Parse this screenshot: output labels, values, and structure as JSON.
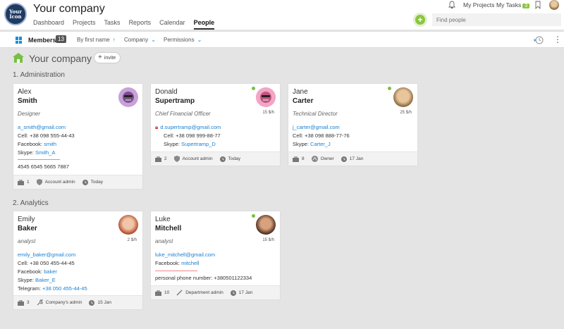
{
  "header": {
    "logo_text": "Your Icon",
    "company": "Your company",
    "nav": [
      "Dashboard",
      "Projects",
      "Tasks",
      "Reports",
      "Calendar",
      "People"
    ],
    "my_projects": "My Projects",
    "my_tasks": "My Tasks",
    "my_tasks_count": "3",
    "search_placeholder": "Find people"
  },
  "subbar": {
    "members_label": "Members",
    "members_count": "13",
    "sort": "By first name",
    "company": "Company",
    "permissions": "Permissions"
  },
  "page": {
    "title": "Your company",
    "invite": "invite"
  },
  "sections": [
    {
      "title": "1. Administration",
      "cards": [
        {
          "first": "Alex",
          "last": "Smith",
          "role": "Designer",
          "rate": "",
          "email": "a_smith@gmail.com",
          "cell_label": "Cell:",
          "cell": "+38 098 555-44-43",
          "fb_label": "Facebook:",
          "fb": "smith",
          "skype_label": "Skype:",
          "skype": "Smith_A",
          "extra": "4545 6545 5665 7887",
          "f1": "1",
          "f2": "Account admin",
          "f3": "Today"
        },
        {
          "first": "Donald",
          "last": "Supertramp",
          "role": "Chief Financial Officer",
          "rate": "15 $/h",
          "email": "d.supertramp@gmail.com",
          "cell_label": "Cell:",
          "cell": "+38 098 999-88-77",
          "skype_label": "Skype:",
          "skype": "Supertramp_D",
          "f1": "2",
          "f2": "Account admin",
          "f3": "Today"
        },
        {
          "first": "Jane",
          "last": "Carter",
          "role": "Technical Director",
          "rate": "25 $/h",
          "email": "j_carter@gmail.com",
          "cell_label": "Cell:",
          "cell": "+38 098 888-77-76",
          "skype_label": "Skype:",
          "skype": "Carter_J",
          "f1": "8",
          "f2": "Owner",
          "f3": "17 Jan"
        }
      ]
    },
    {
      "title": "2. Analytics",
      "cards": [
        {
          "first": "Emily",
          "last": "Baker",
          "role": "analyst",
          "rate": "2 $/h",
          "email": "emily_baker@gmail.com",
          "cell_label": "Cell:",
          "cell": "+38 050 455-44-45",
          "fb_label": "Facebook:",
          "fb": "baker",
          "skype_label": "Skype:",
          "skype": "Baker_E",
          "tg_label": "Telegram:",
          "tg": "+38 050 455-44-45",
          "f1": "3",
          "f2": "Company's admin",
          "f3": "15 Jan"
        },
        {
          "first": "Luke",
          "last": "Mitchell",
          "role": "analyst",
          "rate": "15 $/h",
          "email": "luke_mitchell@gmail.com",
          "fb_label": "Facebook:",
          "fb": "mitchell",
          "extra": "personal phone number: +380501122334",
          "f1": "10",
          "f2": "Department admin",
          "f3": "17 Jan"
        }
      ]
    }
  ]
}
